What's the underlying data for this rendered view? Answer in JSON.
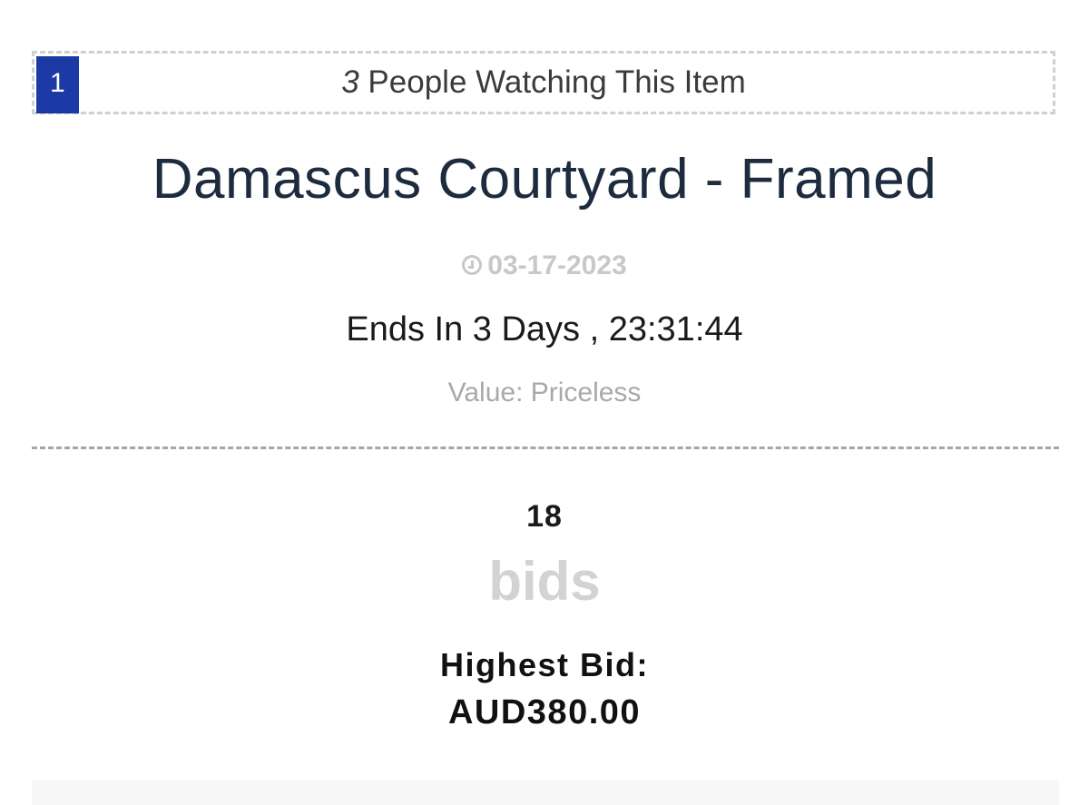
{
  "watchers": {
    "badge": "1",
    "count": "3",
    "text": " People Watching This Item"
  },
  "item": {
    "title": "Damascus Courtyard - Framed",
    "date": "03-17-2023",
    "date_icon": "clock-icon",
    "ends_in": "Ends In 3 Days , 23:31:44",
    "value": "Value: Priceless"
  },
  "bids": {
    "count": "18",
    "label": "bids",
    "highest_label": "Highest Bid:",
    "highest_amount": "AUD380.00"
  },
  "colors": {
    "badge_bg": "#1b3aa5",
    "title": "#1c2b3e",
    "muted": "#c8c8c8"
  }
}
